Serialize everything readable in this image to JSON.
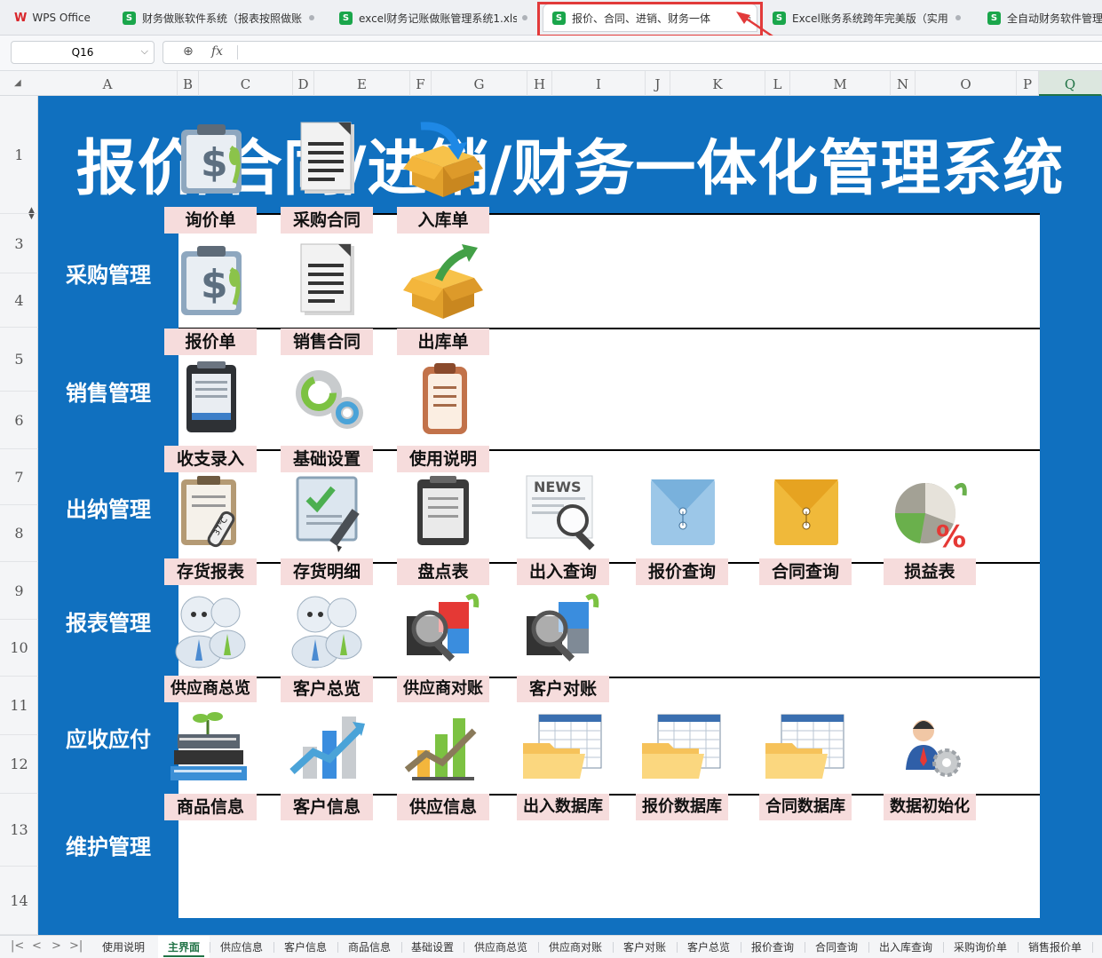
{
  "window_tabs": [
    {
      "label": "WPS Office",
      "type": "wps"
    },
    {
      "label": "财务做账软件系统（报表按照做账",
      "type": "sheet"
    },
    {
      "label": "excel财务记账做账管理系统1.xlsx",
      "type": "sheet"
    },
    {
      "label": "报价、合同、进销、财务一体",
      "type": "sheet",
      "active": true
    },
    {
      "label": "Excel账务系统跨年完美版（实用",
      "type": "sheet"
    },
    {
      "label": "全自动财务软件管理",
      "type": "sheet"
    }
  ],
  "sheet_icon_letter": "S",
  "formula_bar": {
    "cell_ref": "Q16",
    "fx_label": "fx",
    "zoom_icon": "magnifier-icon"
  },
  "columns": [
    "A",
    "B",
    "C",
    "D",
    "E",
    "F",
    "G",
    "H",
    "I",
    "J",
    "K",
    "L",
    "M",
    "N",
    "O",
    "P",
    "Q"
  ],
  "selected_column": "Q",
  "rows": [
    "1",
    "3",
    "4",
    "5",
    "6",
    "7",
    "8",
    "9",
    "10",
    "11",
    "12",
    "13",
    "14"
  ],
  "title": "报价/合同/进销/财务一体化管理系统",
  "sections": [
    {
      "label": "采购管理",
      "items": [
        {
          "label": "询价单",
          "icon": "price-inquiry-clipboard-icon"
        },
        {
          "label": "采购合同",
          "icon": "document-icon"
        },
        {
          "label": "入库单",
          "icon": "box-inbound-icon"
        }
      ]
    },
    {
      "label": "销售管理",
      "items": [
        {
          "label": "报价单",
          "icon": "price-quote-clipboard-icon"
        },
        {
          "label": "销售合同",
          "icon": "document-icon"
        },
        {
          "label": "出库单",
          "icon": "box-outbound-icon"
        }
      ]
    },
    {
      "label": "出纳管理",
      "items": [
        {
          "label": "收支录入",
          "icon": "notepad-icon"
        },
        {
          "label": "基础设置",
          "icon": "gears-icon"
        },
        {
          "label": "使用说明",
          "icon": "clipboard-icon"
        }
      ]
    },
    {
      "label": "报表管理",
      "items": [
        {
          "label": "存货报表",
          "icon": "inventory-report-icon"
        },
        {
          "label": "存货明细",
          "icon": "inventory-detail-icon"
        },
        {
          "label": "盘点表",
          "icon": "stocktake-notepad-icon"
        },
        {
          "label": "出入查询",
          "icon": "news-search-icon"
        },
        {
          "label": "报价查询",
          "icon": "blue-envelope-icon"
        },
        {
          "label": "合同查询",
          "icon": "yellow-envelope-icon"
        },
        {
          "label": "损益表",
          "icon": "pie-percent-icon"
        }
      ]
    },
    {
      "label": "应收应付",
      "items": [
        {
          "label": "供应商总览",
          "icon": "supplier-users-icon"
        },
        {
          "label": "客户总览",
          "icon": "customer-users-icon"
        },
        {
          "label": "供应商对账",
          "icon": "supplier-reconcile-icon"
        },
        {
          "label": "客户对账",
          "icon": "customer-reconcile-icon"
        }
      ]
    },
    {
      "label": "维护管理",
      "items": [
        {
          "label": "商品信息",
          "icon": "books-icon"
        },
        {
          "label": "客户信息",
          "icon": "bar-chart-icon"
        },
        {
          "label": "供应信息",
          "icon": "growth-chart-icon"
        },
        {
          "label": "出入数据库",
          "icon": "folder-table-icon"
        },
        {
          "label": "报价数据库",
          "icon": "folder-table-icon"
        },
        {
          "label": "合同数据库",
          "icon": "folder-table-icon"
        },
        {
          "label": "数据初始化",
          "icon": "user-gear-icon"
        }
      ]
    }
  ],
  "sheet_tabs": [
    "使用说明",
    "主界面",
    "供应信息",
    "客户信息",
    "商品信息",
    "基础设置",
    "供应商总览",
    "供应商对账",
    "客户对账",
    "客户总览",
    "报价查询",
    "合同查询",
    "出入库查询",
    "采购询价单",
    "销售报价单"
  ],
  "active_sheet_tab": "主界面",
  "colors": {
    "background_blue": "#1070bf",
    "label_pink": "#f6dcdc",
    "highlight_red": "#e23a3a",
    "selection_green": "#217346"
  }
}
